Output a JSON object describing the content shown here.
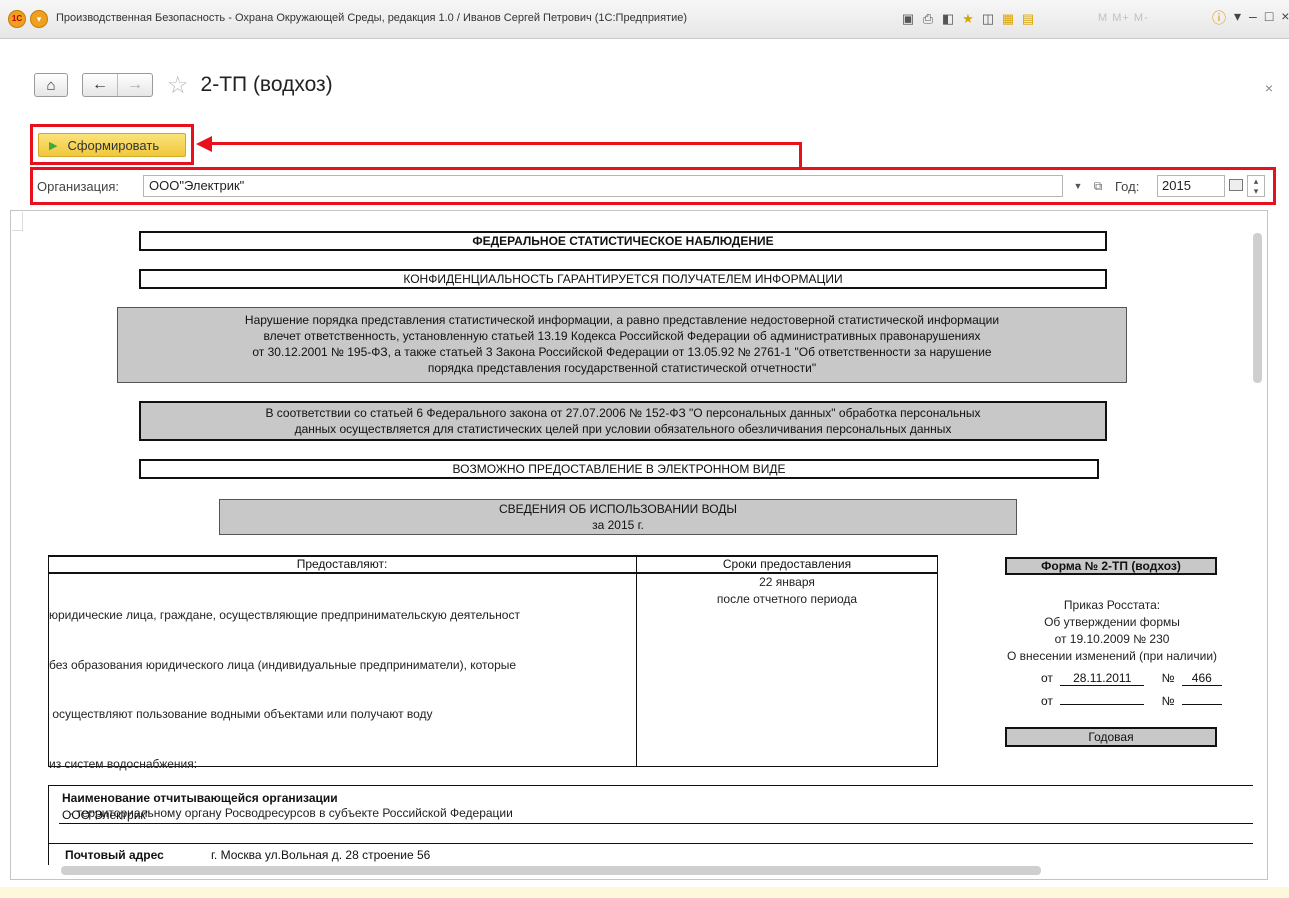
{
  "window": {
    "title": "Производственная Безопасность - Охрана Окружающей Среды, редакция 1.0 / Иванов Сергей Петрович  (1С:Предприятие)",
    "memory_buttons": "M  M+  M-"
  },
  "nav": {
    "title": "2-ТП (водхоз)"
  },
  "toolbar": {
    "generate_label": "Сформировать"
  },
  "filters": {
    "org_label": "Организация:",
    "org_value": "ООО\"Электрик\"",
    "year_label": "Год:",
    "year_value": "2015"
  },
  "report": {
    "h1": "ФЕДЕРАЛЬНОЕ СТАТИСТИЧЕСКОЕ НАБЛЮДЕНИЕ",
    "h2": "КОНФИДЕНЦИАЛЬНОСТЬ ГАРАНТИРУЕТСЯ ПОЛУЧАТЕЛЕМ ИНФОРМАЦИИ",
    "warn": [
      "Нарушение порядка представления статистической информации, а равно представление недостоверной статистической информации",
      "влечет ответственность, установленную статьей 13.19 Кодекса Российской Федерации об административных правонарушениях",
      "от 30.12.2001 № 195-ФЗ, а также статьей 3 Закона Российской Федерации от 13.05.92 № 2761-1 \"Об ответственности за нарушение",
      "порядка представления государственной статистической отчетности\""
    ],
    "personal": [
      "В соответствии со статьей 6 Федерального закона от 27.07.2006 № 152-ФЗ \"О персональных данных\" обработка персональных",
      "данных осуществляется для статистических целей при условии обязательного обезличивания персональных данных"
    ],
    "electronic": "ВОЗМОЖНО ПРЕДОСТАВЛЕНИЕ В ЭЛЕКТРОННОМ ВИДЕ",
    "info_title": "СВЕДЕНИЯ ОБ ИСПОЛЬЗОВАНИИ ВОДЫ",
    "info_period": "за 2015 г.",
    "col_provide": "Предоставляют:",
    "col_deadline": "Сроки предоставления",
    "provide_lines": [
      "юридические лица, граждане, осуществляющие предпринимательскую деятельност",
      "без образования юридического лица (индивидуальные предприниматели), которые",
      " осуществляют пользование водными объектами или получают воду",
      "из систем водоснабжения:",
      "      - территориальному органу Росводресурсов в субъекте Российской Федерации"
    ],
    "deadline_lines": [
      "22 января",
      "после отчетного периода"
    ],
    "form_no": "Форма № 2-ТП (водхоз)",
    "order_lines": [
      "Приказ Росстата:",
      "Об утверждении формы",
      "от 19.10.2009 № 230",
      "О внесении изменений (при наличии)"
    ],
    "from1_label": "от",
    "from1_date": "28.11.2011",
    "no1_label": "№",
    "no1_value": "466",
    "from2_label": "от",
    "no2_label": "№",
    "annual": "Годовая",
    "org_name_label": "Наименование отчитывающейся организации",
    "org_name_value": "ООО\"Электрик\"",
    "postal_label": "Почтовый адрес",
    "postal_value": "г. Москва ул.Вольная д. 28 строение 56"
  }
}
